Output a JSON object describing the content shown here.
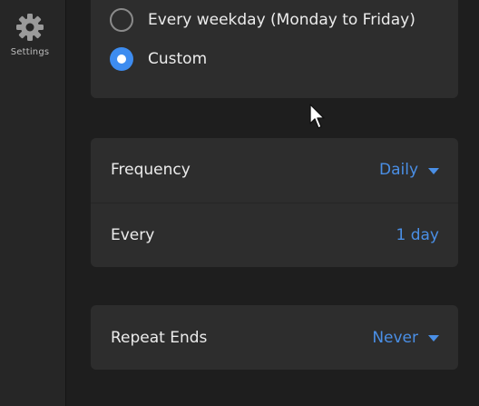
{
  "sidebar": {
    "items": [
      {
        "label": "Settings",
        "icon": "gear-icon"
      }
    ]
  },
  "repeat_options": [
    {
      "label": "Every weekday (Monday to Friday)",
      "selected": false
    },
    {
      "label": "Custom",
      "selected": true
    }
  ],
  "frequency": {
    "label": "Frequency",
    "value": "Daily"
  },
  "every": {
    "label": "Every",
    "value": "1 day"
  },
  "repeat_ends": {
    "label": "Repeat Ends",
    "value": "Never"
  },
  "colors": {
    "accent": "#3d8cf0",
    "link": "#4a8fe6",
    "card_background": "#2d2d2d",
    "page_background": "#1e1e1e",
    "sidebar_background": "#262626"
  }
}
